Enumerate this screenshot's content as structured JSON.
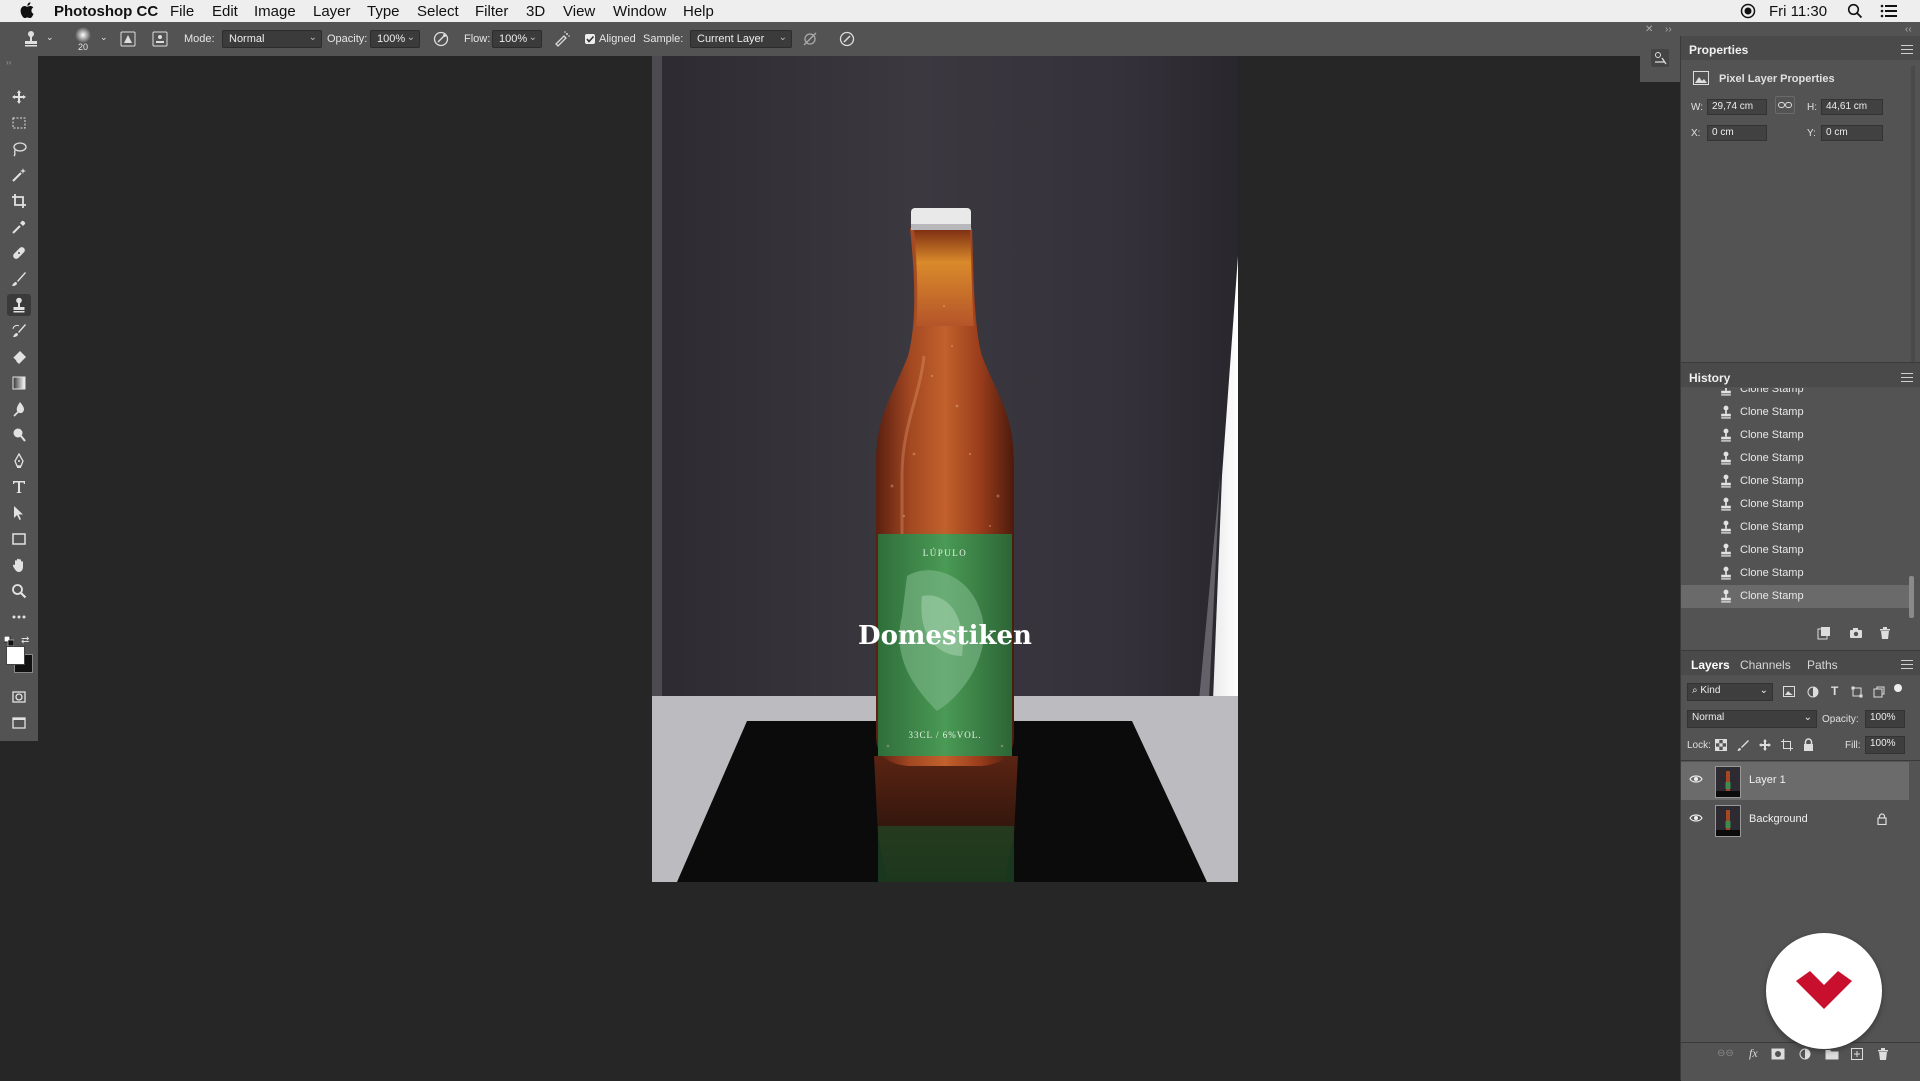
{
  "menubar": {
    "app_name": "Photoshop CC",
    "items": [
      "File",
      "Edit",
      "Image",
      "Layer",
      "Type",
      "Select",
      "Filter",
      "3D",
      "View",
      "Window",
      "Help"
    ],
    "clock": "Fri 11:30"
  },
  "options": {
    "brush_size": "20",
    "mode_label": "Mode:",
    "mode_value": "Normal",
    "opacity_label": "Opacity:",
    "opacity_value": "100%",
    "flow_label": "Flow:",
    "flow_value": "100%",
    "aligned_label": "Aligned",
    "aligned_checked": true,
    "sample_label": "Sample:",
    "sample_value": "Current Layer"
  },
  "photo": {
    "label_top": "LÚPULO",
    "label_brand": "Domestiken",
    "label_bottom": "33CL / 6%VOL."
  },
  "properties": {
    "title": "Properties",
    "subtitle": "Pixel Layer Properties",
    "w_label": "W:",
    "w_value": "29,74 cm",
    "h_label": "H:",
    "h_value": "44,61 cm",
    "x_label": "X:",
    "x_value": "0 cm",
    "y_label": "Y:",
    "y_value": "0 cm"
  },
  "history": {
    "title": "History",
    "items": [
      "Clone Stamp",
      "Clone Stamp",
      "Clone Stamp",
      "Clone Stamp",
      "Clone Stamp",
      "Clone Stamp",
      "Clone Stamp",
      "Clone Stamp",
      "Clone Stamp",
      "Clone Stamp"
    ],
    "selected_index": 9
  },
  "layers_panel": {
    "tabs": [
      "Layers",
      "Channels",
      "Paths"
    ],
    "active_tab": "Layers",
    "kind_label": "Kind",
    "blend_mode": "Normal",
    "opacity_label": "Opacity:",
    "opacity_value": "100%",
    "lock_label": "Lock:",
    "fill_label": "Fill:",
    "fill_value": "100%",
    "layers": [
      {
        "name": "Layer 1",
        "visible": true,
        "selected": true
      },
      {
        "name": "Background",
        "visible": true,
        "locked": true
      }
    ]
  },
  "colors": {
    "accent_logo": "#c8102e",
    "panel_bg": "#535353",
    "canvas_bg": "#262626",
    "label_green": "#3f8a4e"
  }
}
